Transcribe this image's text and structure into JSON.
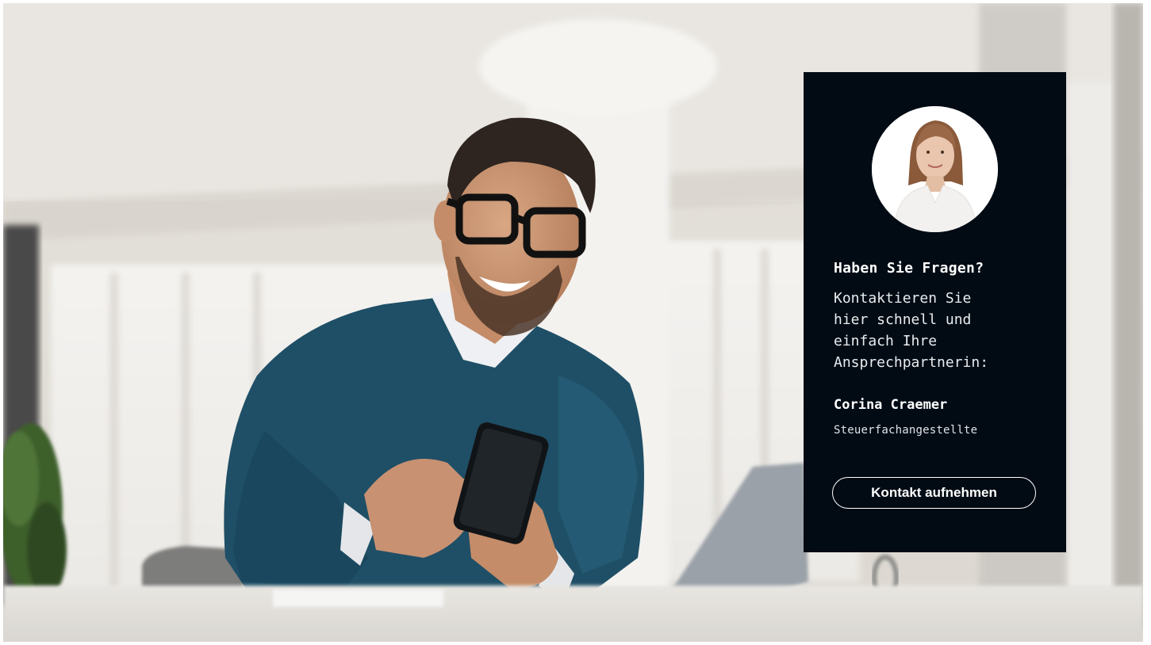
{
  "hero": {
    "photo_subject": "smiling man with glasses using smartphone in bright office"
  },
  "contact_card": {
    "heading": "Haben Sie Fragen?",
    "text": "Kontaktieren Sie\nhier schnell und\neinfach Ihre\nAnsprechpartnerin:",
    "person_name": "Corina Craemer",
    "person_role": "Steuerfachangestellte",
    "button_label": "Kontakt aufnehmen"
  },
  "colors": {
    "card_background": "#020b14",
    "card_text": "#ffffff",
    "sweater": "#1f4f66"
  }
}
